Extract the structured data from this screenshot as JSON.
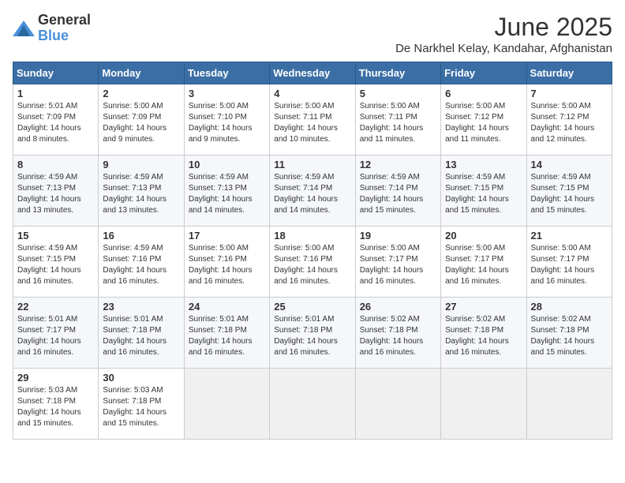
{
  "logo": {
    "general": "General",
    "blue": "Blue"
  },
  "title": "June 2025",
  "location": "De Narkhel Kelay, Kandahar, Afghanistan",
  "days_of_week": [
    "Sunday",
    "Monday",
    "Tuesday",
    "Wednesday",
    "Thursday",
    "Friday",
    "Saturday"
  ],
  "weeks": [
    [
      {
        "day": "1",
        "sunrise": "5:01 AM",
        "sunset": "7:09 PM",
        "daylight": "14 hours and 8 minutes."
      },
      {
        "day": "2",
        "sunrise": "5:00 AM",
        "sunset": "7:09 PM",
        "daylight": "14 hours and 9 minutes."
      },
      {
        "day": "3",
        "sunrise": "5:00 AM",
        "sunset": "7:10 PM",
        "daylight": "14 hours and 9 minutes."
      },
      {
        "day": "4",
        "sunrise": "5:00 AM",
        "sunset": "7:11 PM",
        "daylight": "14 hours and 10 minutes."
      },
      {
        "day": "5",
        "sunrise": "5:00 AM",
        "sunset": "7:11 PM",
        "daylight": "14 hours and 11 minutes."
      },
      {
        "day": "6",
        "sunrise": "5:00 AM",
        "sunset": "7:12 PM",
        "daylight": "14 hours and 11 minutes."
      },
      {
        "day": "7",
        "sunrise": "5:00 AM",
        "sunset": "7:12 PM",
        "daylight": "14 hours and 12 minutes."
      }
    ],
    [
      {
        "day": "8",
        "sunrise": "4:59 AM",
        "sunset": "7:13 PM",
        "daylight": "14 hours and 13 minutes."
      },
      {
        "day": "9",
        "sunrise": "4:59 AM",
        "sunset": "7:13 PM",
        "daylight": "14 hours and 13 minutes."
      },
      {
        "day": "10",
        "sunrise": "4:59 AM",
        "sunset": "7:13 PM",
        "daylight": "14 hours and 14 minutes."
      },
      {
        "day": "11",
        "sunrise": "4:59 AM",
        "sunset": "7:14 PM",
        "daylight": "14 hours and 14 minutes."
      },
      {
        "day": "12",
        "sunrise": "4:59 AM",
        "sunset": "7:14 PM",
        "daylight": "14 hours and 15 minutes."
      },
      {
        "day": "13",
        "sunrise": "4:59 AM",
        "sunset": "7:15 PM",
        "daylight": "14 hours and 15 minutes."
      },
      {
        "day": "14",
        "sunrise": "4:59 AM",
        "sunset": "7:15 PM",
        "daylight": "14 hours and 15 minutes."
      }
    ],
    [
      {
        "day": "15",
        "sunrise": "4:59 AM",
        "sunset": "7:15 PM",
        "daylight": "14 hours and 16 minutes."
      },
      {
        "day": "16",
        "sunrise": "4:59 AM",
        "sunset": "7:16 PM",
        "daylight": "14 hours and 16 minutes."
      },
      {
        "day": "17",
        "sunrise": "5:00 AM",
        "sunset": "7:16 PM",
        "daylight": "14 hours and 16 minutes."
      },
      {
        "day": "18",
        "sunrise": "5:00 AM",
        "sunset": "7:16 PM",
        "daylight": "14 hours and 16 minutes."
      },
      {
        "day": "19",
        "sunrise": "5:00 AM",
        "sunset": "7:17 PM",
        "daylight": "14 hours and 16 minutes."
      },
      {
        "day": "20",
        "sunrise": "5:00 AM",
        "sunset": "7:17 PM",
        "daylight": "14 hours and 16 minutes."
      },
      {
        "day": "21",
        "sunrise": "5:00 AM",
        "sunset": "7:17 PM",
        "daylight": "14 hours and 16 minutes."
      }
    ],
    [
      {
        "day": "22",
        "sunrise": "5:01 AM",
        "sunset": "7:17 PM",
        "daylight": "14 hours and 16 minutes."
      },
      {
        "day": "23",
        "sunrise": "5:01 AM",
        "sunset": "7:18 PM",
        "daylight": "14 hours and 16 minutes."
      },
      {
        "day": "24",
        "sunrise": "5:01 AM",
        "sunset": "7:18 PM",
        "daylight": "14 hours and 16 minutes."
      },
      {
        "day": "25",
        "sunrise": "5:01 AM",
        "sunset": "7:18 PM",
        "daylight": "14 hours and 16 minutes."
      },
      {
        "day": "26",
        "sunrise": "5:02 AM",
        "sunset": "7:18 PM",
        "daylight": "14 hours and 16 minutes."
      },
      {
        "day": "27",
        "sunrise": "5:02 AM",
        "sunset": "7:18 PM",
        "daylight": "14 hours and 16 minutes."
      },
      {
        "day": "28",
        "sunrise": "5:02 AM",
        "sunset": "7:18 PM",
        "daylight": "14 hours and 15 minutes."
      }
    ],
    [
      {
        "day": "29",
        "sunrise": "5:03 AM",
        "sunset": "7:18 PM",
        "daylight": "14 hours and 15 minutes."
      },
      {
        "day": "30",
        "sunrise": "5:03 AM",
        "sunset": "7:18 PM",
        "daylight": "14 hours and 15 minutes."
      },
      null,
      null,
      null,
      null,
      null
    ]
  ]
}
